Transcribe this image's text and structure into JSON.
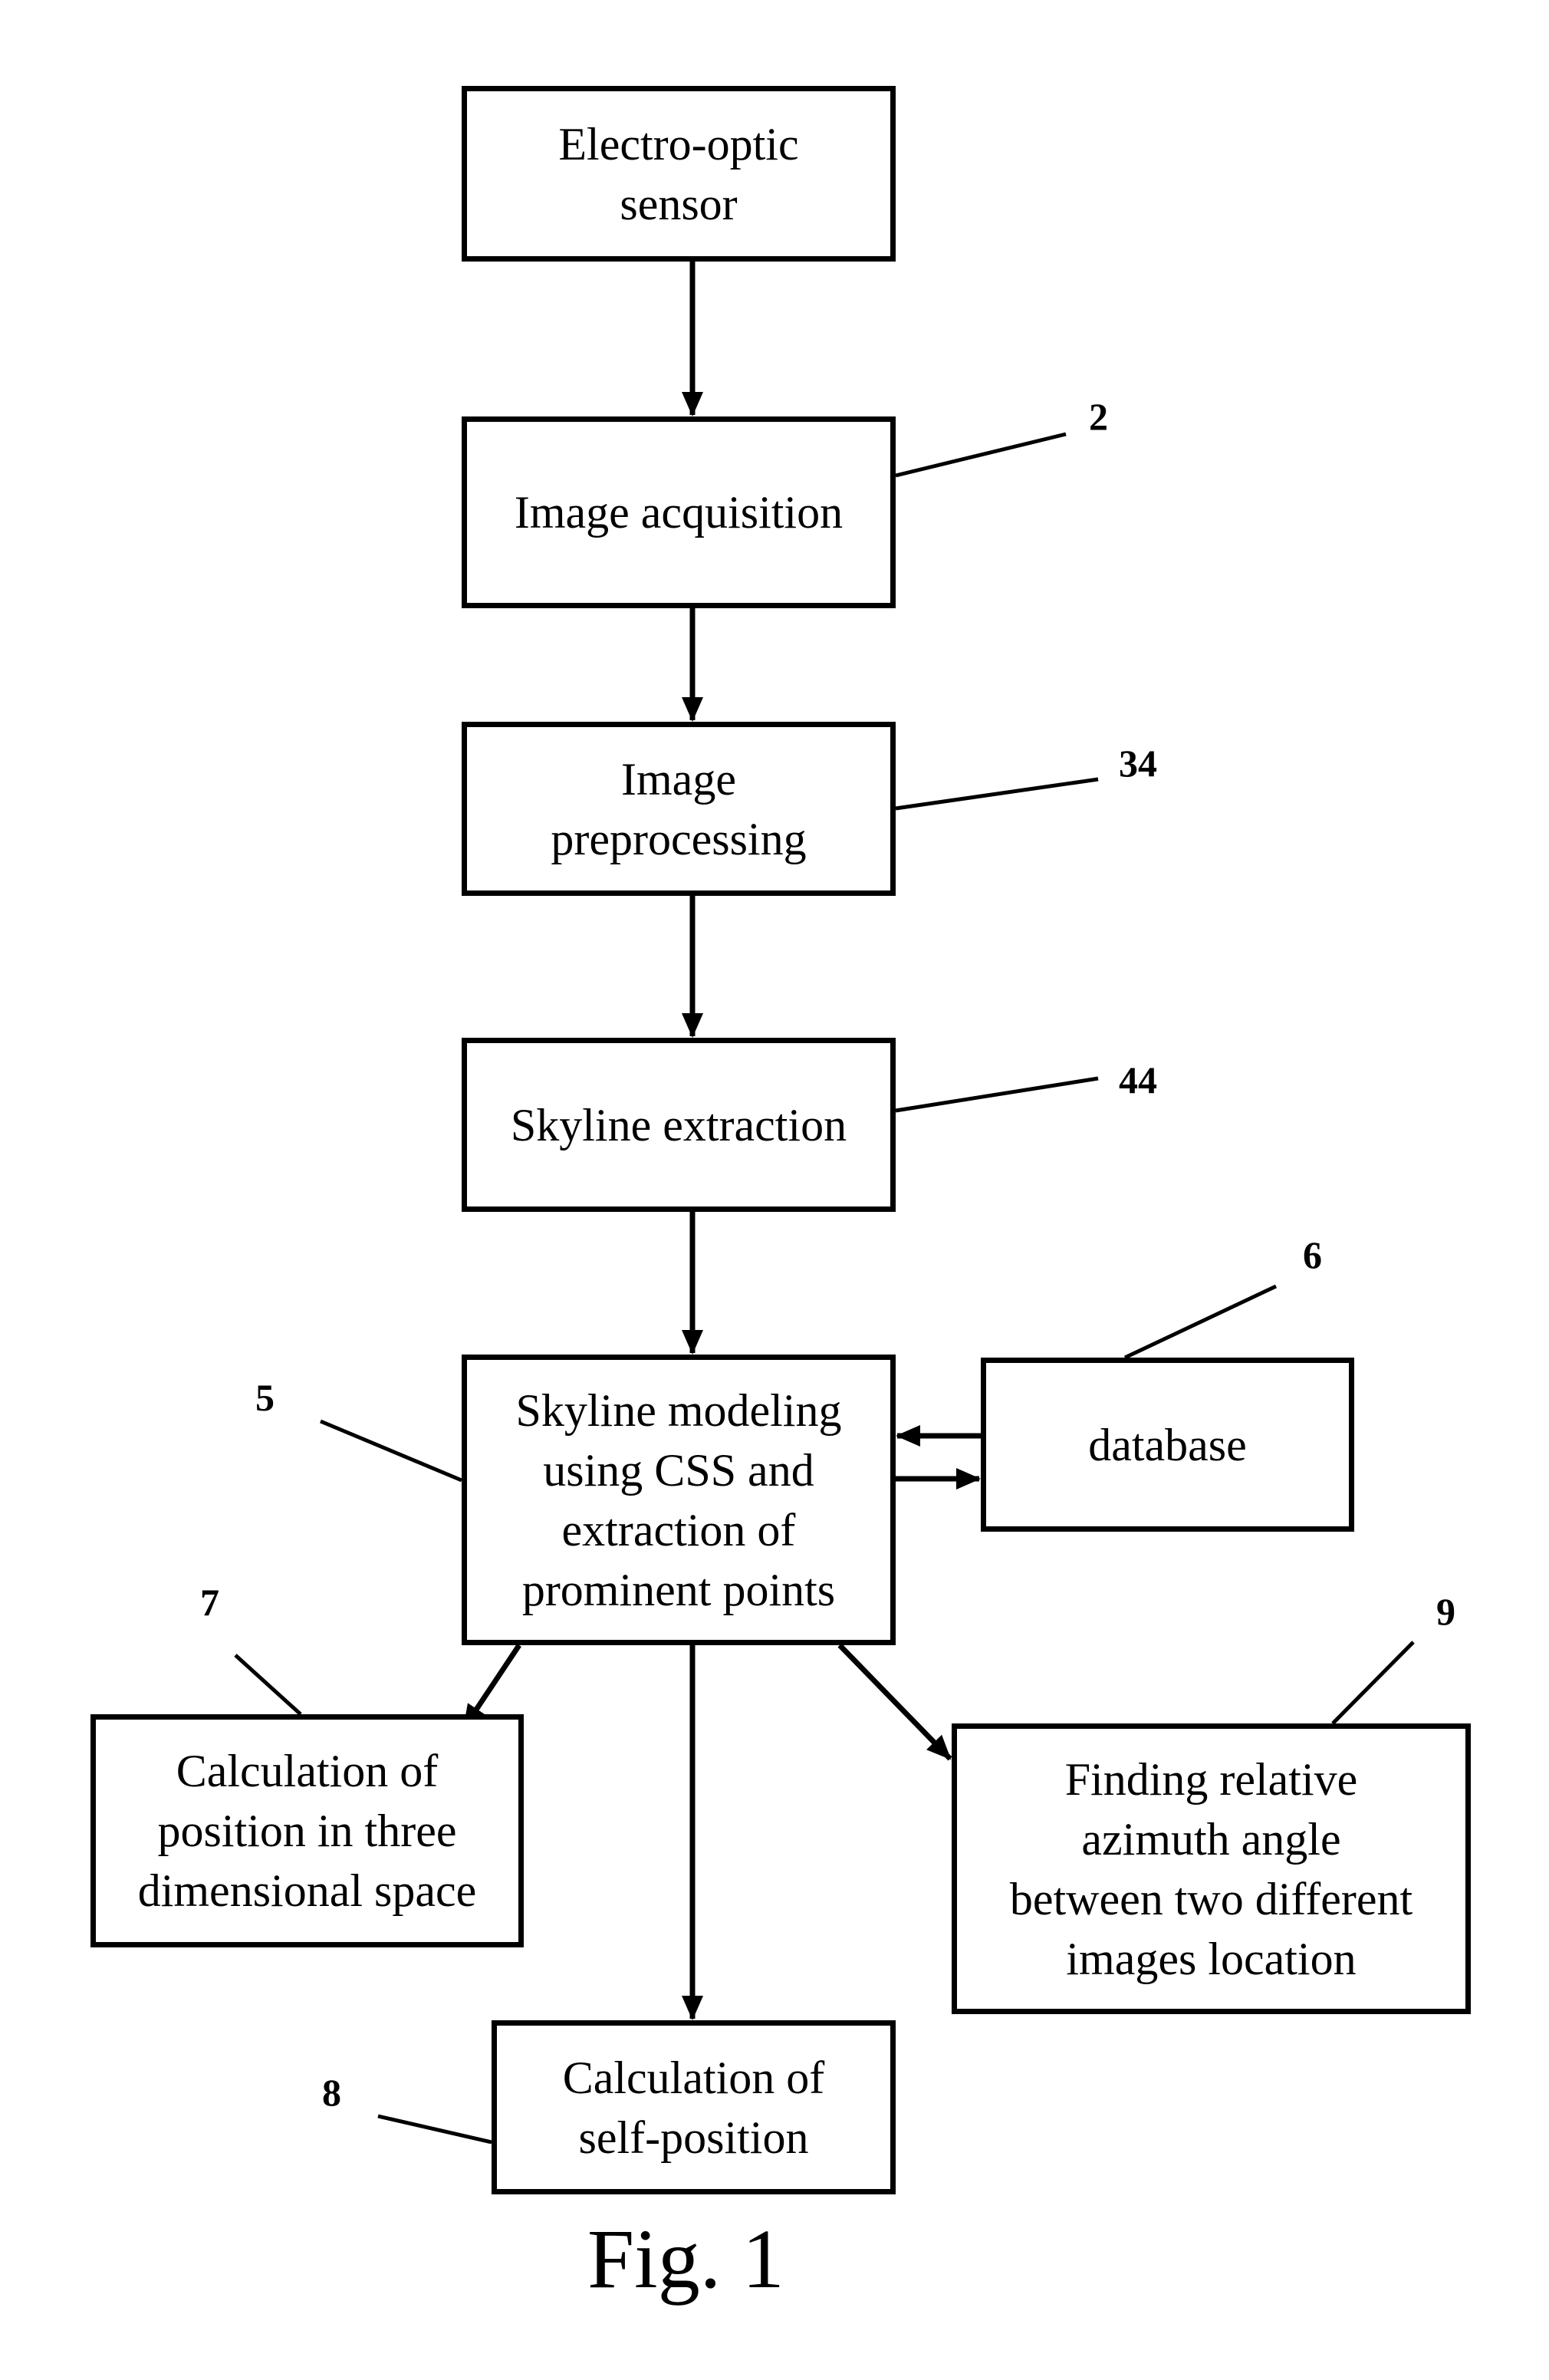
{
  "figure": {
    "caption": "Fig. 1",
    "background": "#ffffff",
    "ink": "#000000"
  },
  "blocks": {
    "sensor": {
      "text": "Electro-optic\nsensor"
    },
    "acquisition": {
      "text": "Image acquisition",
      "ref": "2"
    },
    "preprocessing": {
      "text": "Image\npreprocessing",
      "ref": "34"
    },
    "extraction": {
      "text": "Skyline extraction",
      "ref": "44"
    },
    "modeling": {
      "text": "Skyline modeling\nusing CSS and\nextraction of\nprominent points",
      "ref": "5"
    },
    "database": {
      "text": "database",
      "ref": "6"
    },
    "position3d": {
      "text": "Calculation of\nposition in three\ndimensional space",
      "ref": "7"
    },
    "selfposition": {
      "text": "Calculation of\nself-position",
      "ref": "8"
    },
    "azimuth": {
      "text": "Finding relative\nazimuth angle\nbetween two different\nimages location",
      "ref": "9"
    }
  },
  "connections": [
    {
      "from": "sensor",
      "to": "acquisition"
    },
    {
      "from": "acquisition",
      "to": "preprocessing"
    },
    {
      "from": "preprocessing",
      "to": "extraction"
    },
    {
      "from": "extraction",
      "to": "modeling"
    },
    {
      "from": "database",
      "to": "modeling"
    },
    {
      "from": "modeling",
      "to": "database"
    },
    {
      "from": "modeling",
      "to": "position3d"
    },
    {
      "from": "modeling",
      "to": "selfposition"
    },
    {
      "from": "modeling",
      "to": "azimuth"
    }
  ]
}
